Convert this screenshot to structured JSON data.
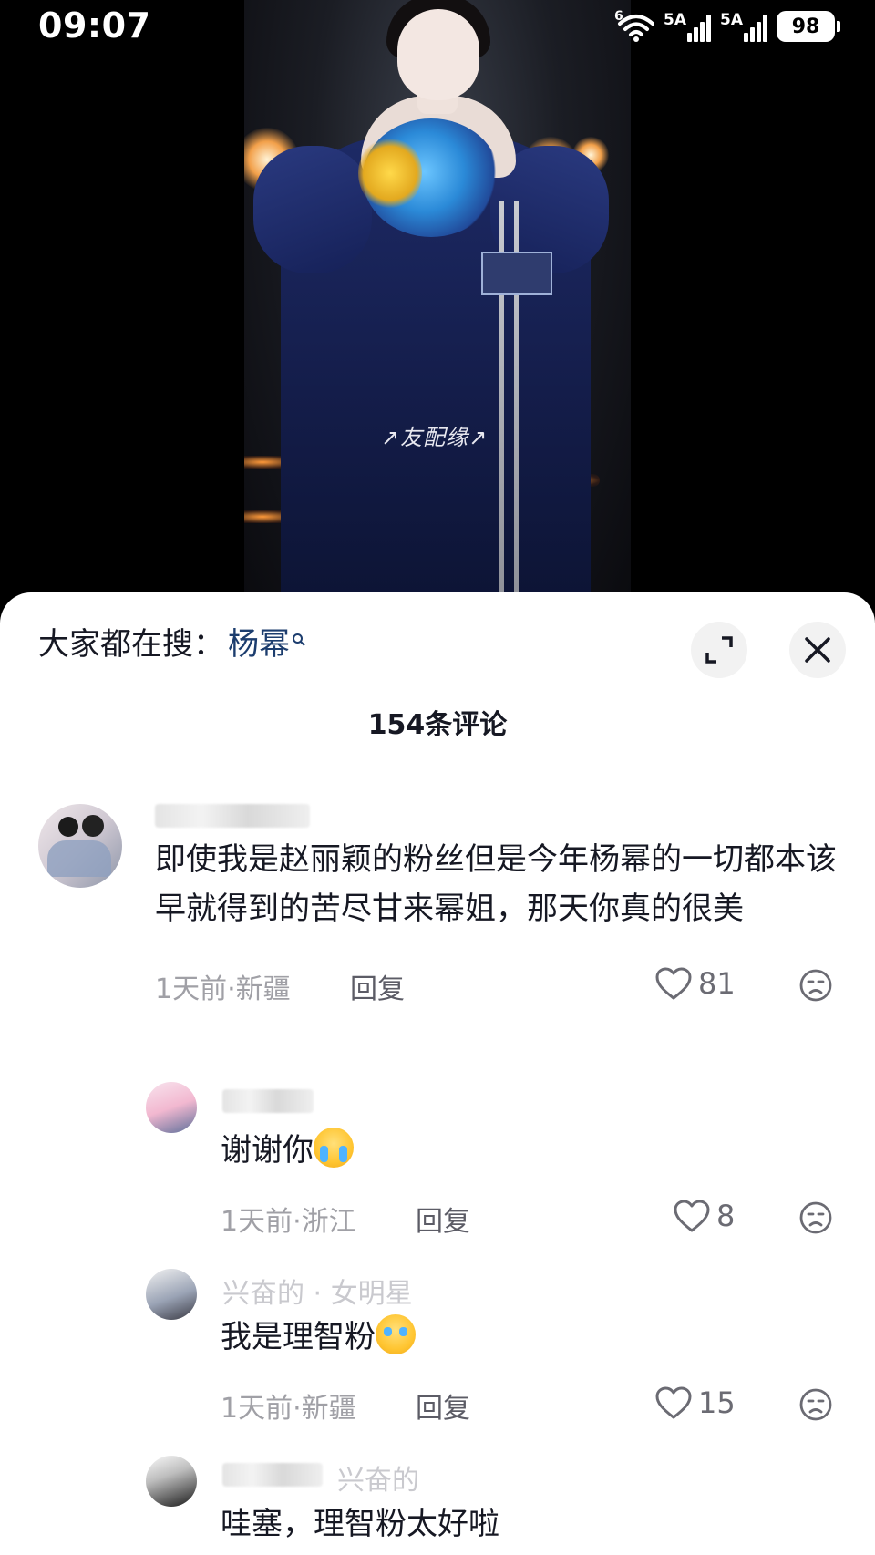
{
  "status_bar": {
    "time": "09:07",
    "wifi_tag": "6",
    "sim1_tag": "5A",
    "sim2_tag": "5A",
    "battery": "98"
  },
  "video": {
    "watermark": "↗友配缘↗"
  },
  "sheet": {
    "search_prefix": "大家都在搜：",
    "search_keyword": "杨幂",
    "comment_count": "154条评论"
  },
  "comments": [
    {
      "text": "即使我是赵丽颖的粉丝但是今年杨幂的一切都本该早就得到的苦尽甘来幂姐，那天你真的很美",
      "meta": "1天前·新疆",
      "reply": "回复",
      "likes": "81"
    },
    {
      "text": "谢谢你",
      "meta": "1天前·浙江",
      "reply": "回复",
      "likes": "8"
    },
    {
      "name_visible": "兴奋的 · 女明星",
      "text": "我是理智粉",
      "meta": "1天前·新疆",
      "reply": "回复",
      "likes": "15"
    },
    {
      "name_visible": "兴奋的",
      "text": "哇塞，理智粉太好啦"
    }
  ],
  "icons": {
    "expand": "expand-icon",
    "close": "close-icon",
    "heart": "heart-icon",
    "dislike": "dislike-face-icon"
  }
}
